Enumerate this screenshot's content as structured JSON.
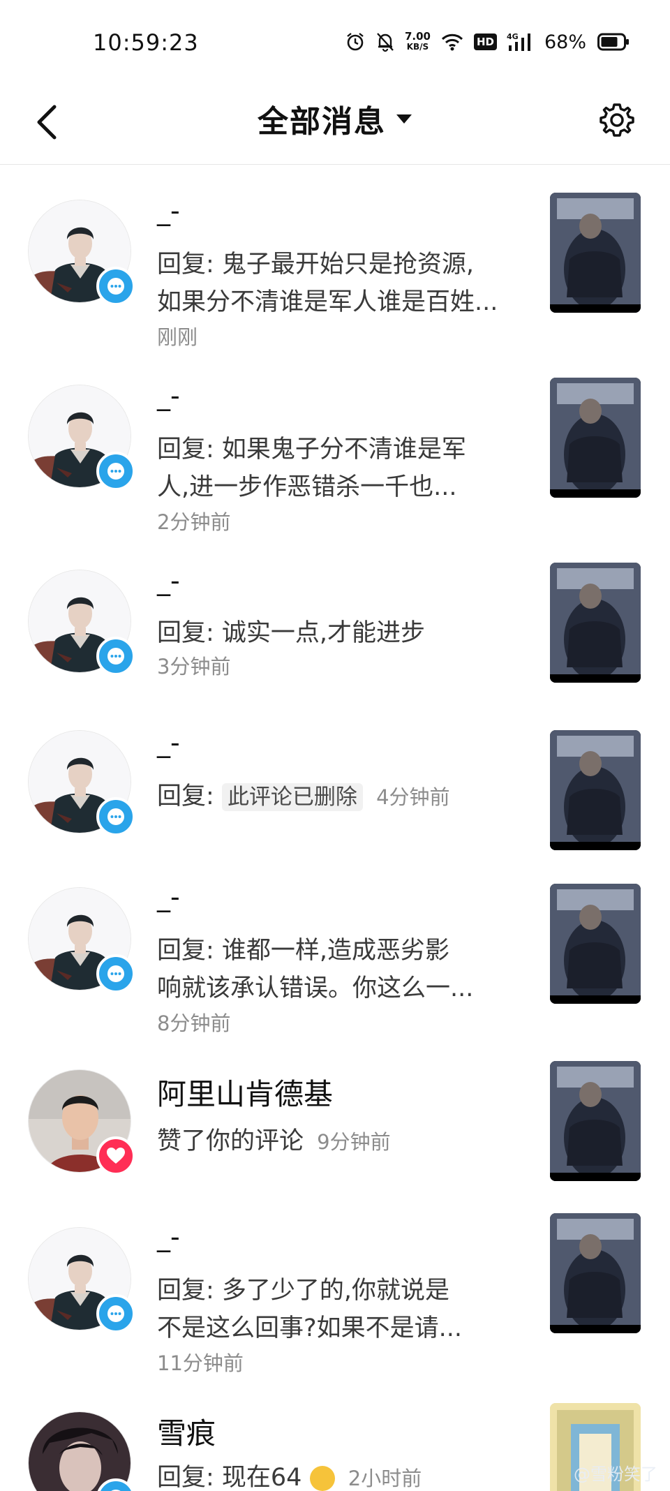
{
  "status": {
    "time": "10:59:23",
    "speed_value": "7.00",
    "speed_unit": "KB/S",
    "hd": "HD",
    "network": "4G",
    "battery": "68%"
  },
  "header": {
    "title": "全部消息"
  },
  "messages": [
    {
      "name": "_-",
      "line1": "回复: 鬼子最开始只是抢资源,",
      "line2": "如果分不清谁是军人谁是百姓...",
      "time": "刚刚",
      "badge": "comment"
    },
    {
      "name": "_-",
      "line1": "回复: 如果鬼子分不清谁是军",
      "line2": "人,进一步作恶错杀一千也...",
      "time": "2分钟前",
      "badge": "comment"
    },
    {
      "name": "_-",
      "line1": "回复: 诚实一点,才能进步",
      "time": "3分钟前",
      "badge": "comment"
    },
    {
      "name": "_-",
      "prefix": "回复:",
      "deleted": "此评论已删除",
      "time": "4分钟前",
      "badge": "comment"
    },
    {
      "name": "_-",
      "line1": "回复: 谁都一样,造成恶劣影",
      "line2": "响就该承认错误。你这么一...",
      "time": "8分钟前",
      "badge": "comment"
    },
    {
      "name": "阿里山肯德基",
      "line1": "赞了你的评论",
      "time": "9分钟前",
      "badge": "like"
    },
    {
      "name": "_-",
      "line1": "回复: 多了少了的,你就说是",
      "line2": "不是这么回事?如果不是请...",
      "time": "11分钟前",
      "badge": "comment"
    },
    {
      "name": "雪痕",
      "line1": "回复: 现在64",
      "time": "2小时前",
      "badge": "comment"
    }
  ],
  "watermark": "@雪粉笑了",
  "icons": [
    "back-arrow-icon",
    "dropdown-triangle-icon",
    "settings-gear-icon",
    "comment-bubble-icon",
    "heart-icon",
    "alarm-icon",
    "mute-bell-icon",
    "wifi-icon",
    "signal-icon",
    "battery-icon"
  ],
  "colors": {
    "comment_badge": "#2aa4ea",
    "like_badge": "#ff2e55",
    "time_text": "#8c8c8c"
  }
}
